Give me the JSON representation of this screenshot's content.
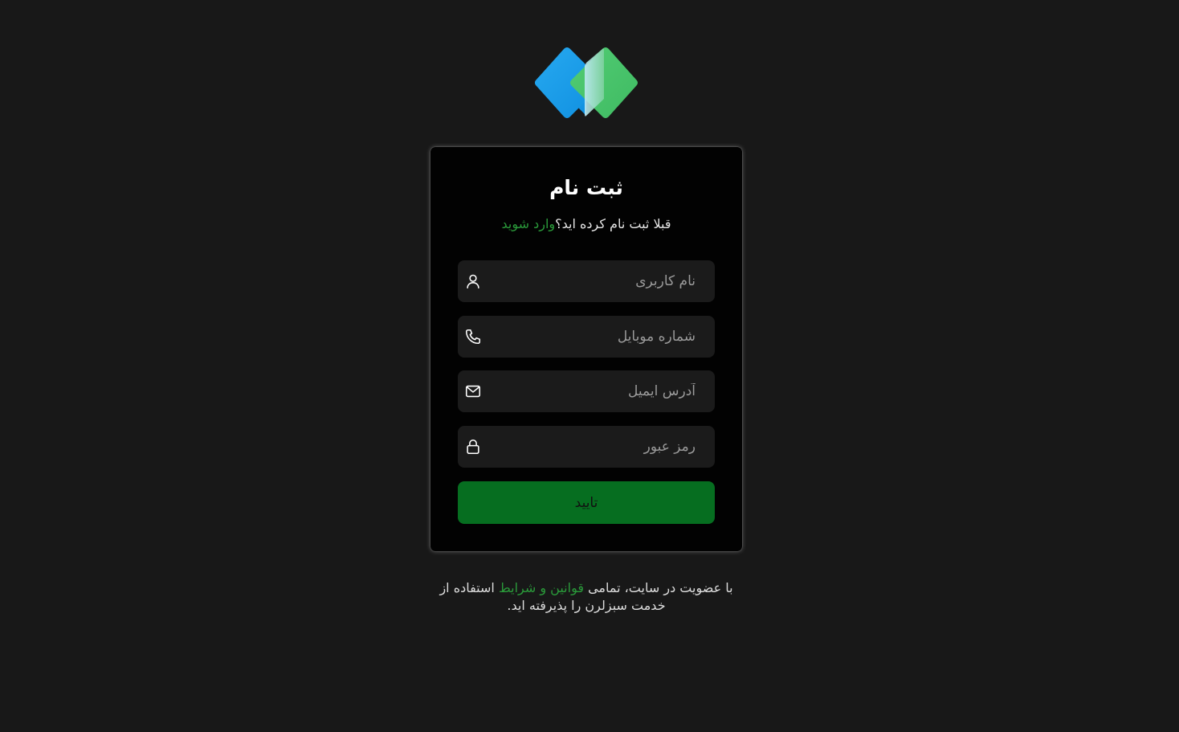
{
  "brand": {
    "logo_icon": "diamond-logo-icon",
    "colors": {
      "blue": "#1a9be8",
      "green": "#47c46a"
    }
  },
  "form": {
    "title": "ثبت نام",
    "login_prompt": "قبلا ثبت نام کرده اید؟",
    "login_link": "وارد شوید",
    "fields": [
      {
        "name": "username",
        "placeholder": "نام کاربری",
        "value": "",
        "icon": "user-icon"
      },
      {
        "name": "mobile",
        "placeholder": "شماره موبایل",
        "value": "",
        "icon": "phone-icon"
      },
      {
        "name": "email",
        "placeholder": "آدرس ایمیل",
        "value": "",
        "icon": "mail-icon"
      },
      {
        "name": "password",
        "placeholder": "رمز عبور",
        "value": "",
        "icon": "lock-icon"
      }
    ],
    "submit_label": "تایید"
  },
  "terms": {
    "prefix": "با عضویت در سایت، تمامی ",
    "link": "قوانین و شرایط",
    "suffix": " استفاده از خدمت سبزلرن را پذیرفته اید."
  },
  "colors": {
    "accent": "#2a9a3a",
    "button": "#066e20",
    "background": "#181818",
    "card": "#020202"
  }
}
